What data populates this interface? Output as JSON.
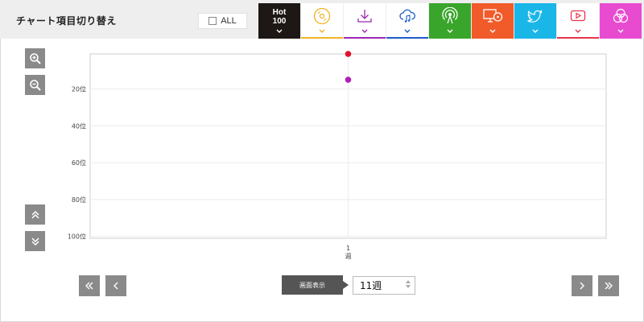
{
  "header": {
    "title": "チャート項目切り替え",
    "all_label": "ALL",
    "all_checked": false
  },
  "tabs": [
    {
      "name": "tab-hot100",
      "label": "Hot\n100",
      "icon": "hot100-text",
      "bg": "#1d1715",
      "accent": "#1d1715",
      "active": true
    },
    {
      "name": "tab-physical",
      "label": "",
      "icon": "cd-icon",
      "bg": "#ffffff",
      "accent": "#f0b323",
      "active": false
    },
    {
      "name": "tab-download",
      "label": "",
      "icon": "download-icon",
      "bg": "#ffffff",
      "accent": "#9c27b0",
      "active": false
    },
    {
      "name": "tab-streaming",
      "label": "",
      "icon": "cloud-music-icon",
      "bg": "#ffffff",
      "accent": "#1e5bc6",
      "active": false
    },
    {
      "name": "tab-radio",
      "label": "",
      "icon": "radio-icon",
      "bg": "#3aa52b",
      "accent": "#3aa52b",
      "active": false
    },
    {
      "name": "tab-lookup",
      "label": "",
      "icon": "pc-cd-icon",
      "bg": "#f15b2a",
      "accent": "#f15b2a",
      "active": false
    },
    {
      "name": "tab-twitter",
      "label": "",
      "icon": "twitter-icon",
      "bg": "#1bb6e8",
      "accent": "#1bb6e8",
      "active": false
    },
    {
      "name": "tab-video",
      "label": "",
      "icon": "video-play-icon",
      "bg": "#ffffff",
      "accent": "#e8334a",
      "active": false
    },
    {
      "name": "tab-karaoke",
      "label": "",
      "icon": "circles-icon",
      "bg": "#e84bd0",
      "accent": "#e84bd0",
      "active": false
    }
  ],
  "chart_data": {
    "type": "line",
    "y_tick_labels": [
      "20位",
      "40位",
      "60位",
      "80位",
      "100位"
    ],
    "y_ticks": [
      20,
      40,
      60,
      80,
      100
    ],
    "ylim": [
      1,
      101
    ],
    "y_inverted": true,
    "x_categories": [
      {
        "num": "1",
        "unit": "週"
      }
    ],
    "grid": true,
    "series": [
      {
        "color": "#e0132d",
        "values": [
          1
        ]
      },
      {
        "color": "#b01fb5",
        "values": [
          15
        ]
      }
    ]
  },
  "bottom_nav": {
    "display_label": "画面表示",
    "week_value": "11週"
  },
  "colors": {
    "header_bg": "#eeeeee",
    "control_gray": "#8a8a8a"
  }
}
